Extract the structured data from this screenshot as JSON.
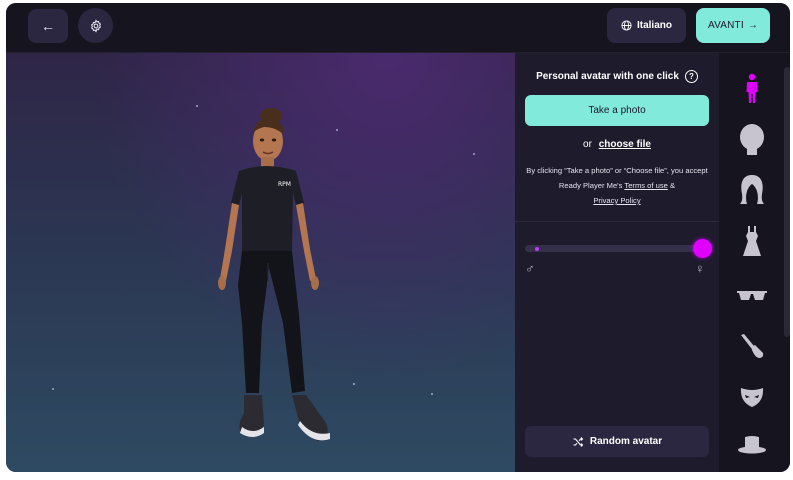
{
  "topbar": {
    "back_label": "←",
    "language_label": "Italiano",
    "next_label": "AVANTI",
    "next_arrow": "→"
  },
  "panel": {
    "title": "Personal avatar with one click",
    "help_glyph": "?",
    "take_photo_label": "Take a photo",
    "or_label": "or",
    "choose_file_label": "choose file",
    "consent_part1": "By clicking “Take a photo” or “Choose file”, you accept Ready Player Me's",
    "terms_label": "Terms of use",
    "consent_amp": "&",
    "privacy_label": "Privacy Policy",
    "body_slider_value": 1.0,
    "male_symbol": "♂",
    "female_symbol": "♀",
    "random_label": "Random avatar"
  },
  "rail": {
    "items": [
      "body-icon",
      "head-icon",
      "hair-icon",
      "outfit-icon",
      "glasses-icon",
      "makeup-icon",
      "mask-icon",
      "hat-icon"
    ],
    "active": "body-icon"
  },
  "colors": {
    "accent": "#82eadb",
    "active": "#e000ff",
    "panel": "#1e1b2c",
    "topbar": "#16141f"
  }
}
